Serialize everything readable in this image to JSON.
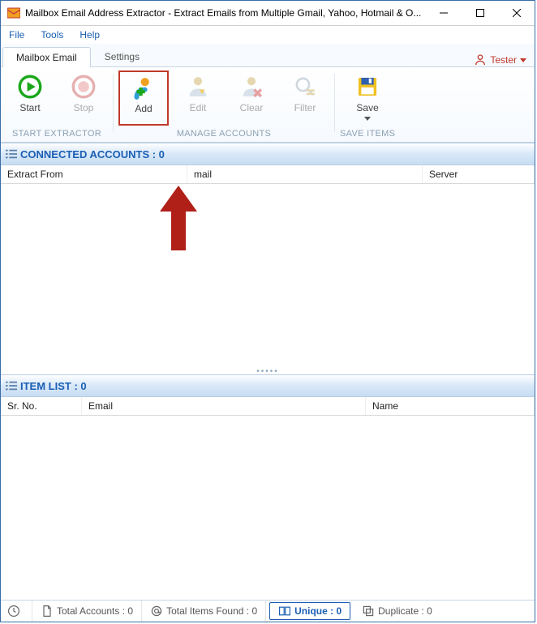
{
  "titlebar": {
    "title": "Mailbox Email Address Extractor - Extract Emails from Multiple Gmail, Yahoo, Hotmail & O..."
  },
  "menu": {
    "file": "File",
    "tools": "Tools",
    "help": "Help"
  },
  "tabs": {
    "mailbox": "Mailbox Email",
    "settings": "Settings",
    "user": "Tester"
  },
  "ribbon": {
    "start": "Start",
    "stop": "Stop",
    "add": "Add",
    "edit": "Edit",
    "clear": "Clear",
    "filter": "Filter",
    "save": "Save",
    "group_extractor": "START EXTRACTOR",
    "group_accounts": "MANAGE ACCOUNTS",
    "group_save": "SAVE ITEMS"
  },
  "connected": {
    "title": "CONNECTED ACCOUNTS : 0",
    "col_from": "Extract From",
    "col_email": "mail",
    "col_server": "Server"
  },
  "itemlist": {
    "title": "ITEM LIST : 0",
    "col_sr": "Sr. No.",
    "col_email": "Email",
    "col_name": "Name"
  },
  "status": {
    "total_accounts": "Total Accounts : 0",
    "total_items": "Total Items Found : 0",
    "unique": "Unique : 0",
    "duplicate": "Duplicate : 0"
  }
}
